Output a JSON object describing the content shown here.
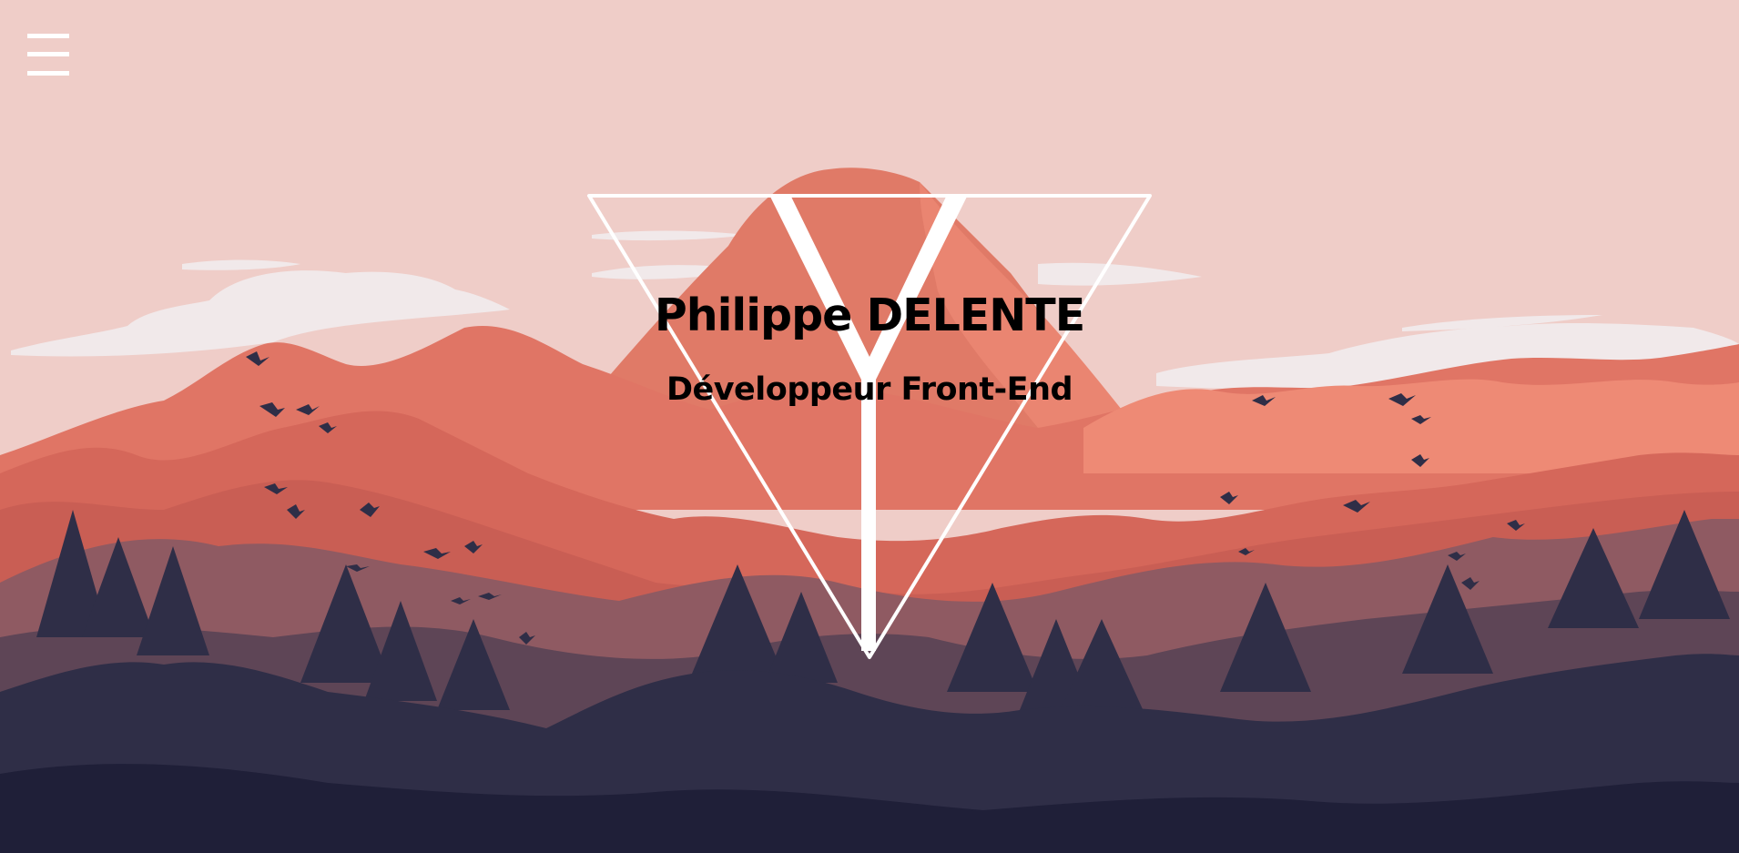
{
  "header": {
    "menu_icon": "hamburger-menu-icon"
  },
  "hero": {
    "name": "Philippe DELENTE",
    "role": "Développeur Front-End",
    "logo": "triangle-y-logo"
  },
  "colors": {
    "sky": "#efcdc8",
    "cloud": "#f1e9ea",
    "mountain_light": "#ee8a75",
    "mountain_mid": "#dc6e5e",
    "mountain_deep": "#c85f55",
    "hill_mauve": "#8f5a62",
    "hill_plum": "#5e4556",
    "forest_dark": "#2f2e47",
    "ground": "#1f1f38",
    "logo_stroke": "#ffffff"
  }
}
